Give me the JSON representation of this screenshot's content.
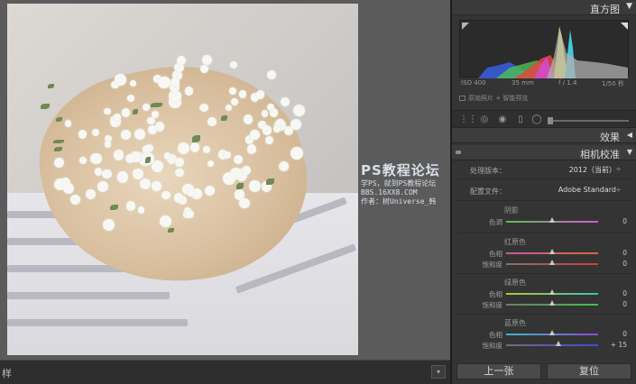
{
  "bottom_bar": {
    "label": "样"
  },
  "watermark": {
    "title": "PS教程论坛",
    "line1": "学PS，就到PS教程论坛",
    "line2": "BBS.16XX8.COM",
    "line3": "作者：树Universe_韩"
  },
  "histogram_panel": {
    "title": "直方图",
    "iso": "ISO 400",
    "focal": "35 mm",
    "aperture": "f / 1.4",
    "shutter": "1/50 秒",
    "original_photo": "原始照片 + 智能预览",
    "colors": {
      "red": "#e8453c",
      "yellow": "#f2e94e",
      "green": "#4fbf54",
      "blue": "#3a5fe0",
      "magenta": "#d24ad6",
      "cyan": "#44c8d9",
      "gray": "#b0b0b0"
    }
  },
  "effects_section": {
    "title": "效果"
  },
  "camera_calibration": {
    "title": "相机校准",
    "process_label": "处理版本：",
    "process_value": "2012（当前）",
    "profile_label": "配置文件：",
    "profile_value": "Adobe Standard",
    "shadows": {
      "title": "阴影",
      "rows": [
        {
          "label": "色调",
          "value": "0"
        }
      ]
    },
    "red_primary": {
      "title": "红原色",
      "rows": [
        {
          "label": "色相",
          "value": "0"
        },
        {
          "label": "饱和度",
          "value": "0"
        }
      ]
    },
    "green_primary": {
      "title": "绿原色",
      "rows": [
        {
          "label": "色相",
          "value": "0"
        },
        {
          "label": "饱和度",
          "value": "0"
        }
      ]
    },
    "blue_primary": {
      "title": "蓝原色",
      "rows": [
        {
          "label": "色相",
          "value": "0"
        },
        {
          "label": "饱和度",
          "value": "+ 15"
        }
      ]
    }
  },
  "buttons": {
    "previous": "上一张",
    "reset": "复位"
  }
}
